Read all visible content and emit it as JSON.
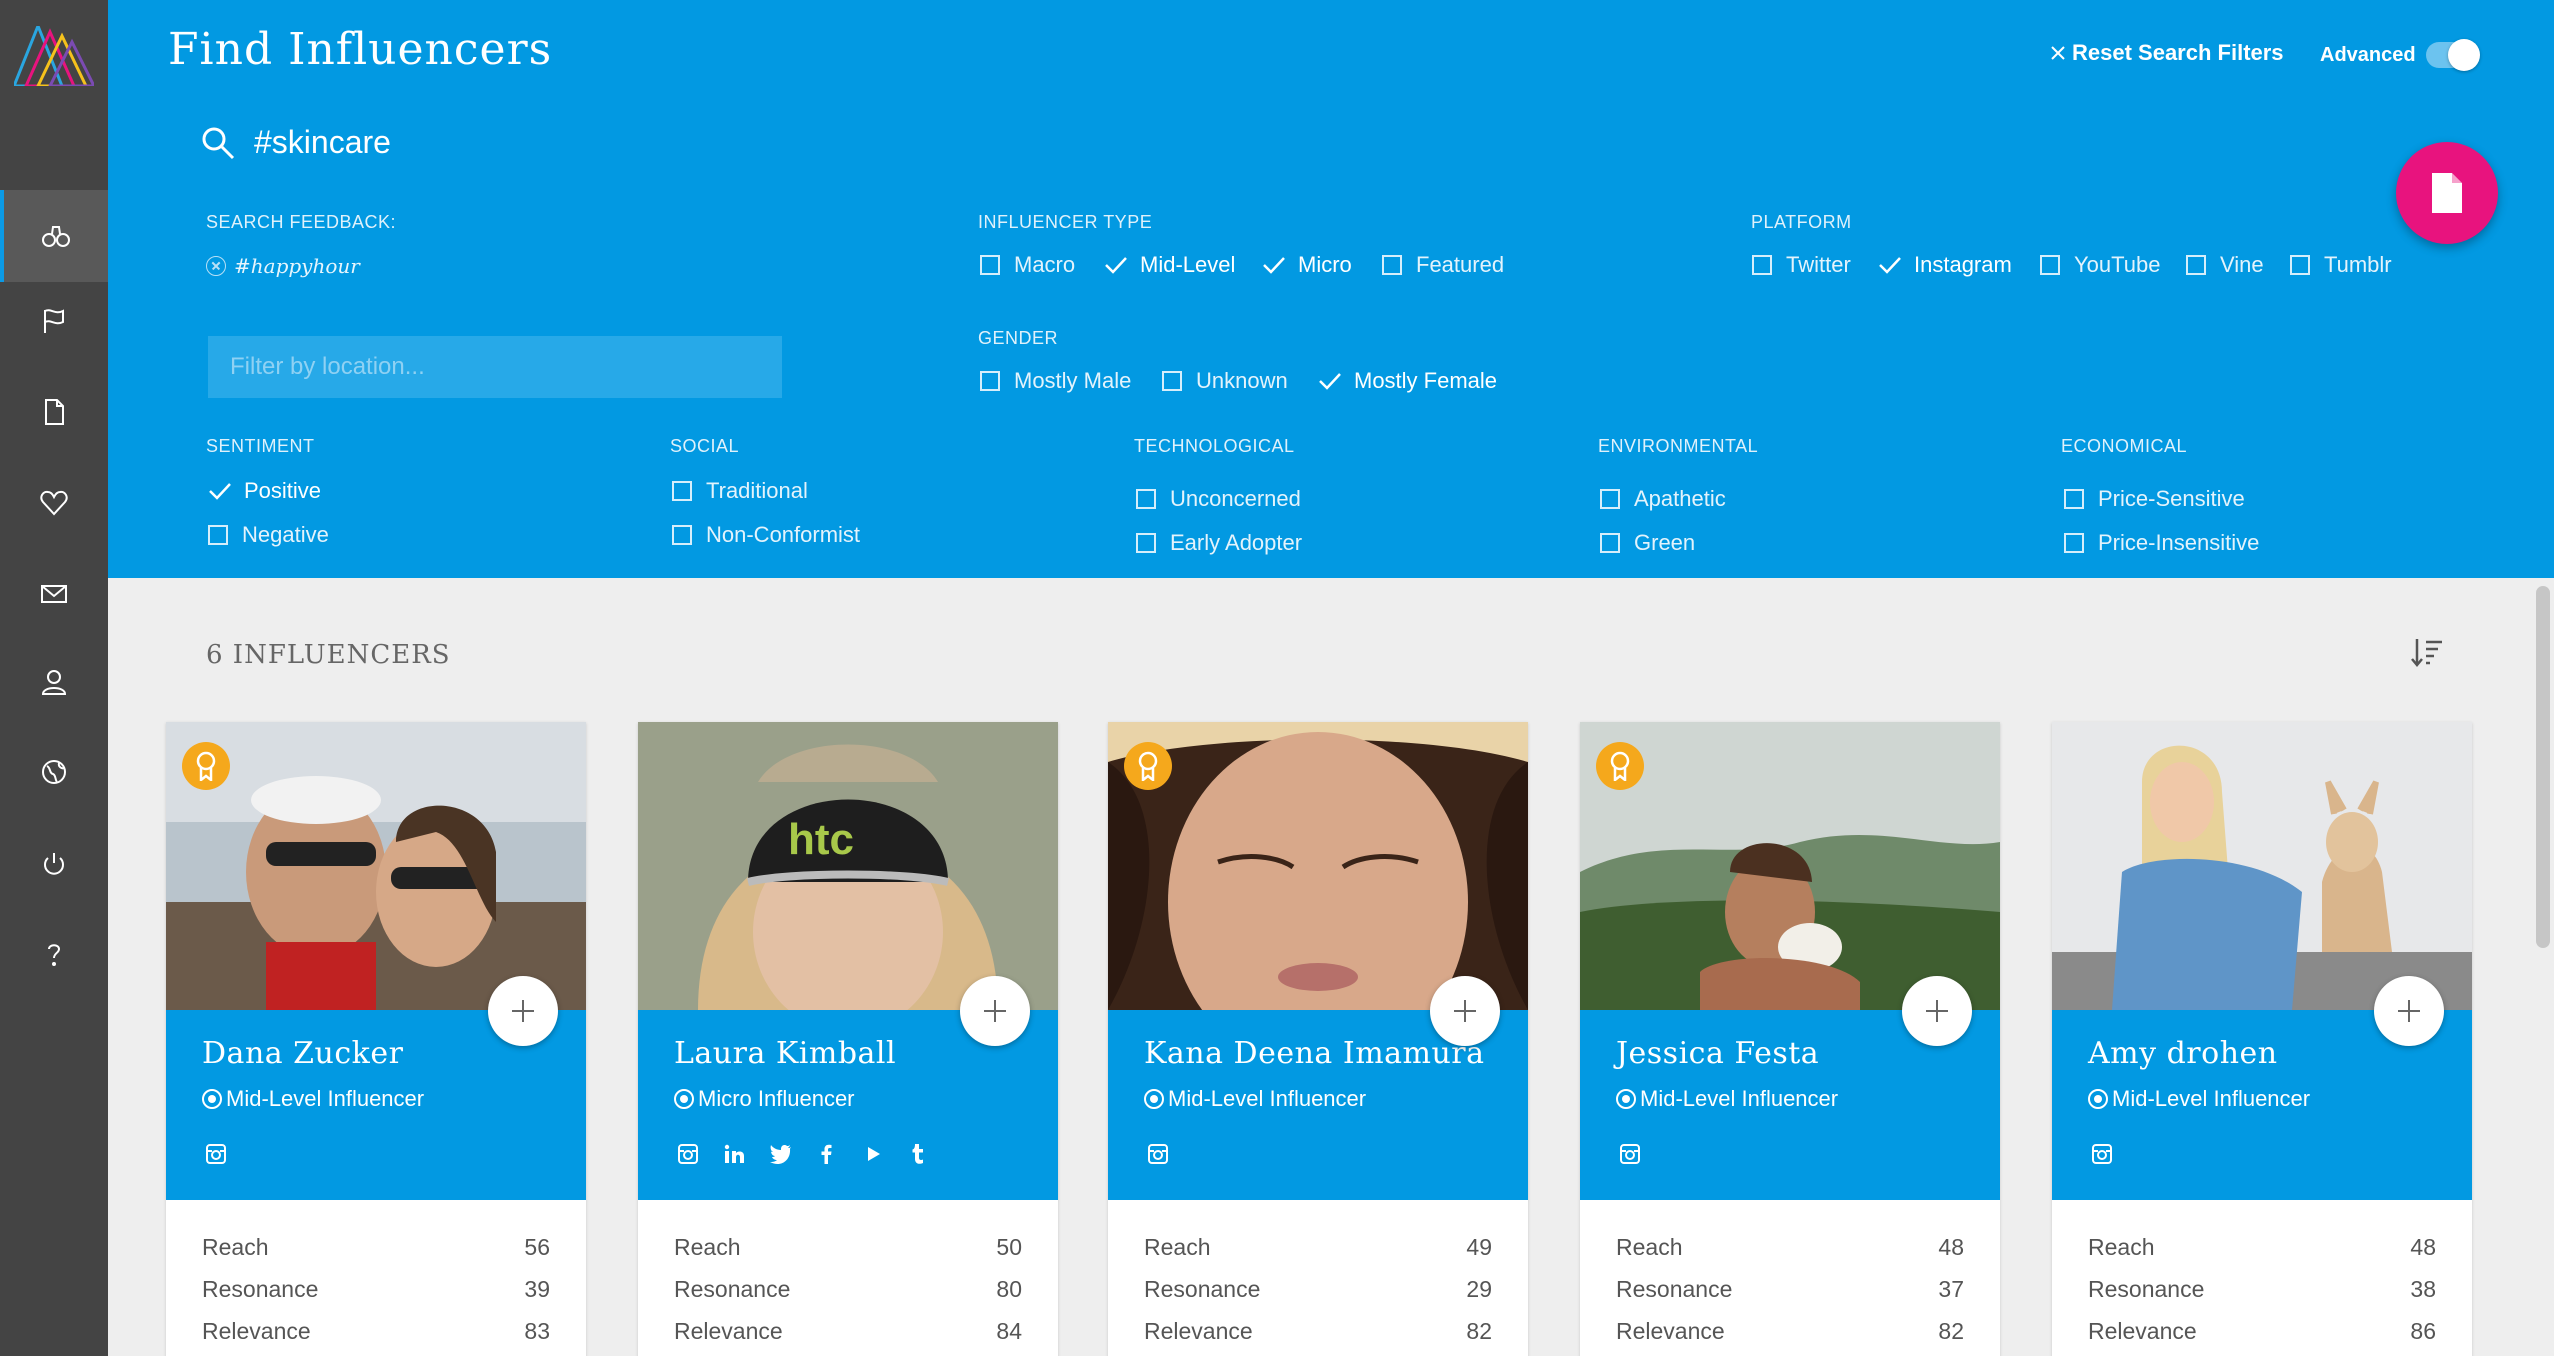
{
  "header": {
    "title": "Find Influencers",
    "reset_label": "Reset Search Filters",
    "advanced_label": "Advanced",
    "advanced_on": true
  },
  "search": {
    "value": "#skincare"
  },
  "feedback": {
    "label": "SEARCH FEEDBACK:",
    "chip": "#happyhour"
  },
  "location": {
    "placeholder": "Filter by location..."
  },
  "filters": {
    "influencer_type": {
      "label": "INFLUENCER TYPE",
      "options": [
        {
          "label": "Macro",
          "checked": false
        },
        {
          "label": "Mid-Level",
          "checked": true
        },
        {
          "label": "Micro",
          "checked": true
        },
        {
          "label": "Featured",
          "checked": false
        }
      ]
    },
    "platform": {
      "label": "PLATFORM",
      "options": [
        {
          "label": "Twitter",
          "checked": false
        },
        {
          "label": "Instagram",
          "checked": true
        },
        {
          "label": "YouTube",
          "checked": false
        },
        {
          "label": "Vine",
          "checked": false
        },
        {
          "label": "Tumblr",
          "checked": false
        }
      ]
    },
    "gender": {
      "label": "GENDER",
      "options": [
        {
          "label": "Mostly Male",
          "checked": false
        },
        {
          "label": "Unknown",
          "checked": false
        },
        {
          "label": "Mostly Female",
          "checked": true
        }
      ]
    },
    "sentiment": {
      "label": "SENTIMENT",
      "options": [
        {
          "label": "Positive",
          "checked": true
        },
        {
          "label": "Negative",
          "checked": false
        }
      ]
    },
    "social": {
      "label": "SOCIAL",
      "options": [
        {
          "label": "Traditional",
          "checked": false
        },
        {
          "label": "Non-Conformist",
          "checked": false
        }
      ]
    },
    "technological": {
      "label": "TECHNOLOGICAL",
      "options": [
        {
          "label": "Unconcerned",
          "checked": false
        },
        {
          "label": "Early Adopter",
          "checked": false
        }
      ]
    },
    "environmental": {
      "label": "ENVIRONMENTAL",
      "options": [
        {
          "label": "Apathetic",
          "checked": false
        },
        {
          "label": "Green",
          "checked": false
        }
      ]
    },
    "economical": {
      "label": "ECONOMICAL",
      "options": [
        {
          "label": "Price-Sensitive",
          "checked": false
        },
        {
          "label": "Price-Insensitive",
          "checked": false
        }
      ]
    }
  },
  "results": {
    "title": "6 INFLUENCERS",
    "stat_labels": [
      "Reach",
      "Resonance",
      "Relevance"
    ],
    "cards": [
      {
        "name": "Dana Zucker",
        "type": "Mid-Level Influencer",
        "featured": true,
        "socials": [
          "instagram-icon"
        ],
        "reach": "56",
        "resonance": "39",
        "relevance": "83"
      },
      {
        "name": "Laura Kimball",
        "type": "Micro Influencer",
        "featured": false,
        "socials": [
          "instagram-icon",
          "linkedin-icon",
          "twitter-icon",
          "facebook-icon",
          "youtube-icon",
          "tumblr-icon"
        ],
        "reach": "50",
        "resonance": "80",
        "relevance": "84"
      },
      {
        "name": "Kana Deena Imamura",
        "type": "Mid-Level Influencer",
        "featured": true,
        "socials": [
          "instagram-icon"
        ],
        "reach": "49",
        "resonance": "29",
        "relevance": "82"
      },
      {
        "name": "Jessica Festa",
        "type": "Mid-Level Influencer",
        "featured": true,
        "socials": [
          "instagram-icon"
        ],
        "reach": "48",
        "resonance": "37",
        "relevance": "82"
      },
      {
        "name": "Amy drohen",
        "type": "Mid-Level Influencer",
        "featured": false,
        "socials": [
          "instagram-icon"
        ],
        "reach": "48",
        "resonance": "38",
        "relevance": "86"
      }
    ]
  },
  "colors": {
    "brand_blue": "#0299e2",
    "sidebar": "#444444",
    "fab_pink": "#e8137e",
    "badge_gold": "#f5a81c"
  }
}
